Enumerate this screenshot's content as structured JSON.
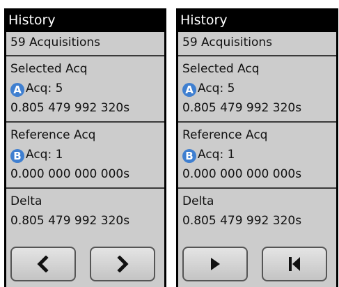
{
  "panels": [
    {
      "title": "History",
      "acquisitions": "59 Acquisitions",
      "selected": {
        "label": "Selected Acq",
        "badge": "A",
        "acq": "Acq: 5",
        "time": "0.805 479 992 320s"
      },
      "reference": {
        "label": "Reference Acq",
        "badge": "B",
        "acq": "Acq: 1",
        "time": "0.000 000 000 000s"
      },
      "delta": {
        "label": "Delta",
        "time": "0.805 479 992 320s"
      },
      "buttons": [
        "chevron-left-icon",
        "chevron-right-icon"
      ]
    },
    {
      "title": "History",
      "acquisitions": "59 Acquisitions",
      "selected": {
        "label": "Selected Acq",
        "badge": "A",
        "acq": "Acq: 5",
        "time": "0.805 479 992 320s"
      },
      "reference": {
        "label": "Reference Acq",
        "badge": "B",
        "acq": "Acq: 1",
        "time": "0.000 000 000 000s"
      },
      "delta": {
        "label": "Delta",
        "time": "0.805 479 992 320s"
      },
      "buttons": [
        "play-icon",
        "skip-to-start-icon"
      ]
    }
  ],
  "colors": {
    "badge": "#3f7fd0",
    "panel_bg": "#cccccc",
    "header_bg": "#000000"
  }
}
